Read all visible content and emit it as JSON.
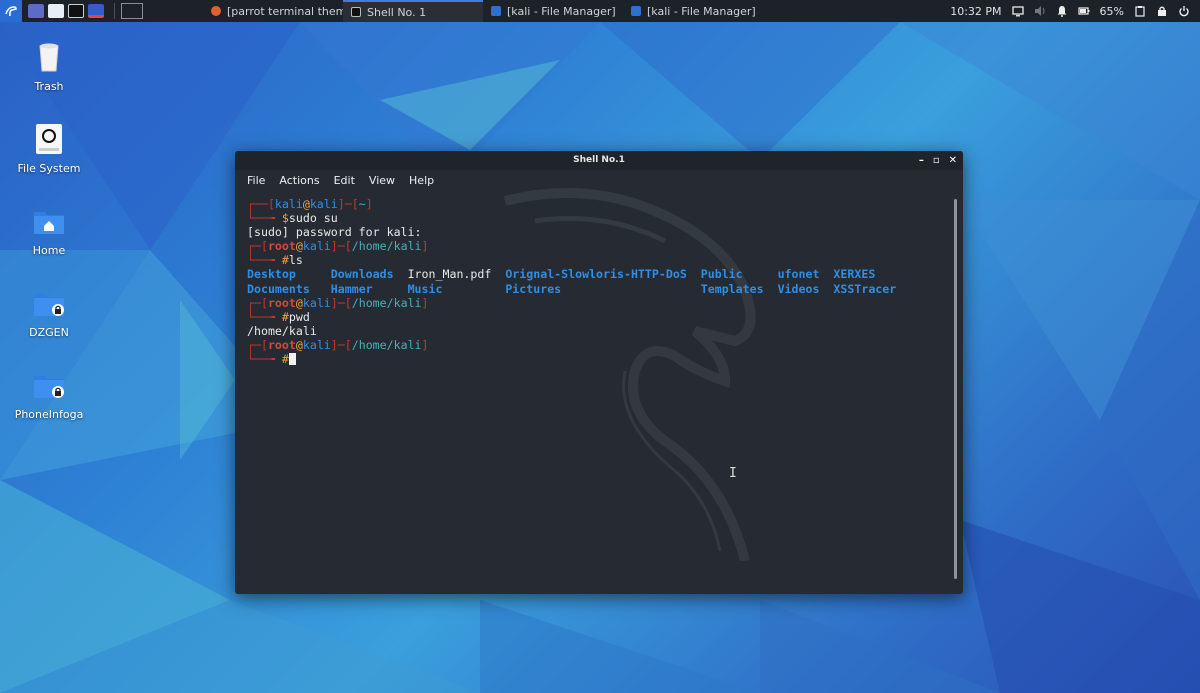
{
  "taskbar": {
    "tasks": [
      {
        "label": "[parrot terminal theme -...",
        "active": false
      },
      {
        "label": "Shell No. 1",
        "active": true
      },
      {
        "label": "[kali - File Manager]",
        "active": false
      },
      {
        "label": "[kali - File Manager]",
        "active": false
      }
    ],
    "clock": "10:32 PM",
    "battery": "65%"
  },
  "desktop": {
    "icons": [
      {
        "label": "Trash"
      },
      {
        "label": "File System"
      },
      {
        "label": "Home"
      },
      {
        "label": "DZGEN"
      },
      {
        "label": "PhoneInfoga"
      }
    ]
  },
  "terminal": {
    "title": "Shell No.1",
    "menu": [
      "File",
      "Actions",
      "Edit",
      "View",
      "Help"
    ],
    "prompt1": {
      "user": "kali",
      "host": "kali",
      "path": "~",
      "sym": "$",
      "cmd": "sudo su"
    },
    "sudo_line": "[sudo] password for kali:",
    "prompt2": {
      "user": "root",
      "host": "kali",
      "path": "/home/kali",
      "sym": "#",
      "cmd": "ls"
    },
    "ls_row1": [
      "Desktop",
      "Downloads",
      "Iron_Man.pdf",
      "Orignal-Slowloris-HTTP-DoS",
      "Public",
      "ufonet",
      "XERXES"
    ],
    "ls_row2": [
      "Documents",
      "Hammer",
      "Music",
      "Pictures",
      "Templates",
      "Videos",
      "XSSTracer"
    ],
    "prompt3": {
      "user": "root",
      "host": "kali",
      "path": "/home/kali",
      "sym": "#",
      "cmd": "pwd"
    },
    "pwd_out": "/home/kali",
    "prompt4": {
      "user": "root",
      "host": "kali",
      "path": "/home/kali",
      "sym": "#",
      "cmd": ""
    }
  }
}
